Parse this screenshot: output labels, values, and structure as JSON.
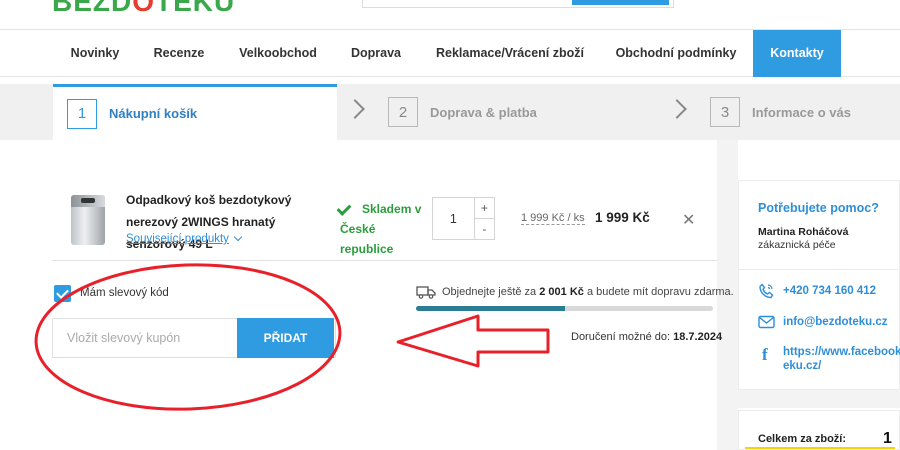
{
  "header": {
    "logo_text": "BEZDOTEKU",
    "brand_colors": {
      "green": "#3aa84a",
      "red": "#e63b2e"
    }
  },
  "nav": {
    "items": [
      {
        "label": "Novinky"
      },
      {
        "label": "Recenze"
      },
      {
        "label": "Velkoobchod"
      },
      {
        "label": "Doprava"
      },
      {
        "label": "Reklamace/Vrácení zboží"
      },
      {
        "label": "Obchodní podmínky"
      },
      {
        "label": "Kontakty",
        "active": true
      }
    ]
  },
  "steps": [
    {
      "number": "1",
      "label": "Nákupní košík",
      "active": true
    },
    {
      "number": "2",
      "label": "Doprava & platba",
      "active": false
    },
    {
      "number": "3",
      "label": "Informace o vás",
      "active": false
    }
  ],
  "cart": {
    "item": {
      "name": "Odpadkový koš bezdotykový nerezový 2WINGS hranatý senzorový 49 L",
      "related_label": "Související produkty",
      "stock": "Skladem v České republice",
      "quantity": "1",
      "qty_plus": "+",
      "qty_minus": "-",
      "unit_price": "1 999 Kč / ks",
      "total_price": "1 999 Kč",
      "remove_symbol": "✕"
    },
    "discount": {
      "checkbox_label": "Mám slevový kód",
      "checked": true,
      "coupon_placeholder": "Vložit slevový kupón",
      "coupon_button": "PŘIDAT"
    },
    "shipping": {
      "text_before": "Objednejte ještě za",
      "amount": "2 001 Kč",
      "text_after": "a budete mít dopravu zdarma.",
      "progress_fraction": 0.5,
      "delivery_label": "Doručení možné do:",
      "delivery_date": "18.7.2024"
    }
  },
  "help": {
    "title": "Potřebujete pomoc?",
    "name": "Martina Roháčová",
    "role": "zákaznická péče",
    "phone": "+420 734 160 412",
    "email": "info@bezdoteku.cz",
    "facebook_line1": "https://www.facebook.c",
    "facebook_line2": "eku.cz/"
  },
  "summary": {
    "label": "Celkem za zboží:",
    "annotation_number": "1"
  },
  "colors": {
    "accent": "#2f9be0",
    "stock_green": "#2c9d3c",
    "annotation_red": "#e8202a",
    "progress": "#2a7d93"
  }
}
